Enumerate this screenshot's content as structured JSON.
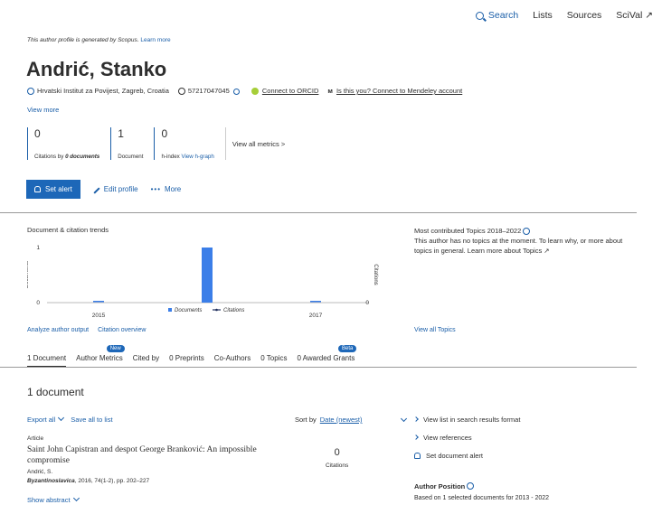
{
  "nav": {
    "items": [
      "Search",
      "Lists",
      "Sources",
      "SciVal ↗"
    ]
  },
  "notice": {
    "text": "This author profile is generated by Scopus.",
    "link": "Learn more"
  },
  "author": {
    "name": "Andrić, Stanko",
    "affiliation": "Hrvatski Institut za Povijest, Zagreb, Croatia",
    "scopus_id": "57217047045",
    "orcid": "Connect to ORCID",
    "mendeley": "Is this you? Connect to Mendeley account",
    "view_more": "View more"
  },
  "metrics": [
    {
      "value": "0",
      "label_prefix": "Citations by",
      "label_em": "0 documents"
    },
    {
      "value": "1",
      "label": "Document"
    },
    {
      "value": "0",
      "label": "h-index",
      "link": "View h-graph"
    }
  ],
  "view_all_metrics": "View all metrics >",
  "actions": {
    "set_alert": "Set alert",
    "edit_profile": "Edit profile",
    "more": "More"
  },
  "trends": {
    "title": "Document & citation trends",
    "analyze": "Analyze author output",
    "overview": "Citation overview"
  },
  "chart_data": {
    "type": "bar",
    "x": [
      2015,
      2016,
      2017
    ],
    "series": [
      {
        "name": "Documents",
        "values": [
          0,
          1,
          0
        ],
        "color": "#3b7ee8"
      },
      {
        "name": "Citations",
        "values": [
          0,
          0,
          0
        ],
        "color": "#1f2f5c"
      }
    ],
    "xticks": [
      "2015",
      "2017"
    ],
    "ylabel": "Documents",
    "y2label": "Citations",
    "yticks_left": [
      "1",
      "0"
    ],
    "yticks_right": [
      "0"
    ],
    "ylim": [
      0,
      1
    ]
  },
  "topics": {
    "title": "Most contributed Topics 2018–2022",
    "body": "This author has no topics at the moment. To learn why, or more about topics in general. Learn more about Topics ↗",
    "view_all": "View all Topics"
  },
  "tabs": [
    {
      "label": "1 Document"
    },
    {
      "label": "Author Metrics",
      "badge": "New"
    },
    {
      "label": "Cited by"
    },
    {
      "label": "0 Preprints"
    },
    {
      "label": "Co-Authors"
    },
    {
      "label": "0 Topics"
    },
    {
      "label": "0 Awarded Grants",
      "badge": "Beta"
    }
  ],
  "documents": {
    "heading": "1 document",
    "export_all": "Export all",
    "save_all": "Save all to list",
    "sort_label": "Sort by",
    "sort_value": "Date (newest)"
  },
  "article": {
    "type": "Article",
    "title": "Saint John Capistran and despot George Branković: An impossible compromise",
    "authors": "Andrić, S.",
    "source": "Byzantinoslavica",
    "source_rest": ", 2016, 74(1-2), pp. 202–227",
    "citations": "0",
    "citations_label": "Citations",
    "show_abstract": "Show abstract"
  },
  "side_links": {
    "list_format": "View list in search results format",
    "references": "View references",
    "doc_alert": "Set document alert"
  },
  "author_position": {
    "title": "Author Position",
    "sub": "Based on 1 selected documents for 2013 - 2022"
  }
}
